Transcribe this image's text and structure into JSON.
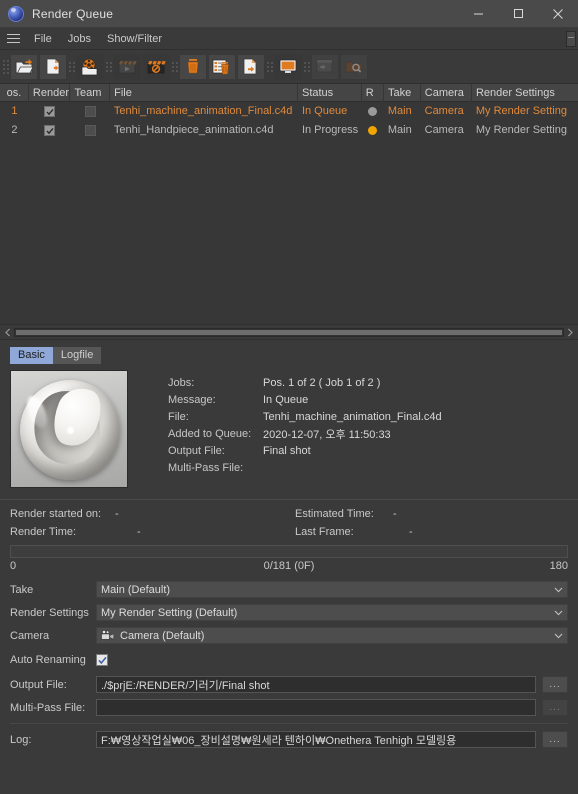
{
  "window": {
    "title": "Render Queue",
    "app_icon": "cinema4d-logo-icon",
    "minimize_label": "Minimize",
    "maximize_label": "Maximize",
    "close_label": "Close"
  },
  "menubar": {
    "hamburger": "menu-icon",
    "items": [
      {
        "label": "File"
      },
      {
        "label": "Jobs"
      },
      {
        "label": "Show/Filter"
      }
    ]
  },
  "toolbar": {
    "groups": [
      {
        "buttons": [
          {
            "name": "open-job-button",
            "icon": "folder-open-icon",
            "enabled": true
          },
          {
            "name": "add-job-button",
            "icon": "file-add-icon",
            "enabled": true
          }
        ]
      },
      {
        "buttons": [
          {
            "name": "load-batch-render-button",
            "icon": "render-folder-icon",
            "enabled": true
          }
        ]
      },
      {
        "buttons": [
          {
            "name": "start-rendering-button",
            "icon": "clapper-play-icon",
            "enabled": false
          },
          {
            "name": "stop-rendering-button",
            "icon": "clapper-stop-icon",
            "enabled": true
          }
        ]
      },
      {
        "buttons": [
          {
            "name": "delete-job-button",
            "icon": "trash-icon",
            "enabled": true
          },
          {
            "name": "clear-finished-button",
            "icon": "list-trash-icon",
            "enabled": true
          },
          {
            "name": "export-job-button",
            "icon": "file-export-icon",
            "enabled": true
          }
        ]
      },
      {
        "buttons": [
          {
            "name": "show-render-window-button",
            "icon": "monitor-icon",
            "enabled": true
          }
        ]
      },
      {
        "buttons": [
          {
            "name": "open-render-output-button",
            "icon": "window-export-icon",
            "enabled": false
          },
          {
            "name": "inspect-render-button",
            "icon": "folder-search-icon",
            "enabled": false
          }
        ]
      }
    ]
  },
  "table": {
    "columns": [
      {
        "key": "pos",
        "label": "os."
      },
      {
        "key": "render",
        "label": "Render"
      },
      {
        "key": "team",
        "label": "Team"
      },
      {
        "key": "file",
        "label": "File"
      },
      {
        "key": "status",
        "label": "Status"
      },
      {
        "key": "r",
        "label": "R"
      },
      {
        "key": "take",
        "label": "Take"
      },
      {
        "key": "camera",
        "label": "Camera"
      },
      {
        "key": "rs",
        "label": "Render Settings"
      }
    ],
    "rows": [
      {
        "pos": "1",
        "render_checked": true,
        "team_checked": false,
        "file": "Tenhi_machine_animation_Final.c4d",
        "status": "In Queue",
        "status_dot": "#9a9a9a",
        "take": "Main",
        "camera": "Camera",
        "render_settings": "My Render Setting",
        "selected": true
      },
      {
        "pos": "2",
        "render_checked": true,
        "team_checked": false,
        "file": "Tenhi_Handpiece_animation.c4d",
        "status": "In Progress",
        "status_dot": "#f0a500",
        "take": "Main",
        "camera": "Camera",
        "render_settings": "My Render Setting",
        "selected": false
      }
    ]
  },
  "tabs": [
    {
      "label": "Basic",
      "active": true
    },
    {
      "label": "Logfile",
      "active": false
    }
  ],
  "detail": {
    "thumbnail_name": "render-preview-thumbnail",
    "fields": [
      {
        "key": "Jobs:",
        "value": "Pos. 1 of 2 ( Job 1 of 2 )"
      },
      {
        "key": "Message:",
        "value": "In Queue"
      },
      {
        "key": "File:",
        "value": "Tenhi_machine_animation_Final.c4d"
      },
      {
        "key": "Added to Queue:",
        "value": "2020-12-07, 오후 11:50:33"
      },
      {
        "key": "Output File:",
        "value": "Final shot"
      },
      {
        "key": "Multi-Pass File:",
        "value": ""
      }
    ]
  },
  "render_status": {
    "started_on_label": "Render started on:",
    "started_on_value": "-",
    "render_time_label": "Render Time:",
    "render_time_value": "-",
    "estimated_time_label": "Estimated Time:",
    "estimated_time_value": "-",
    "last_frame_label": "Last Frame:",
    "last_frame_value": "-",
    "progress_percent": 0,
    "progress_left": "0",
    "progress_mid": "0/181 (0F)",
    "progress_right": "180"
  },
  "form": {
    "take": {
      "label": "Take",
      "value": "Main (Default)"
    },
    "render_settings": {
      "label": "Render Settings",
      "value": "My Render Setting (Default)"
    },
    "camera": {
      "label": "Camera",
      "value": "Camera (Default)",
      "icon": "camera-icon"
    },
    "auto_renaming": {
      "label": "Auto Renaming",
      "checked": true
    },
    "output_file": {
      "label": "Output File:",
      "value": "./$prjE:/RENDER/기러기/Final shot",
      "browse_label": "...",
      "browse_enabled": true
    },
    "multipass_file": {
      "label": "Multi-Pass File:",
      "value": "",
      "browse_label": "...",
      "browse_enabled": false
    },
    "log": {
      "label": "Log:",
      "value": "F:₩영상작업실₩06_장비설명₩원세라 텐하이₩Onethera Tenhigh 모델링용",
      "browse_label": "...",
      "browse_enabled": true
    }
  },
  "colors": {
    "accent_orange": "#e08a3c",
    "tab_active": "#8fa8d8",
    "status_queue": "#9a9a9a",
    "status_progress": "#f0a500",
    "window_bg": "#3a3a3a"
  }
}
